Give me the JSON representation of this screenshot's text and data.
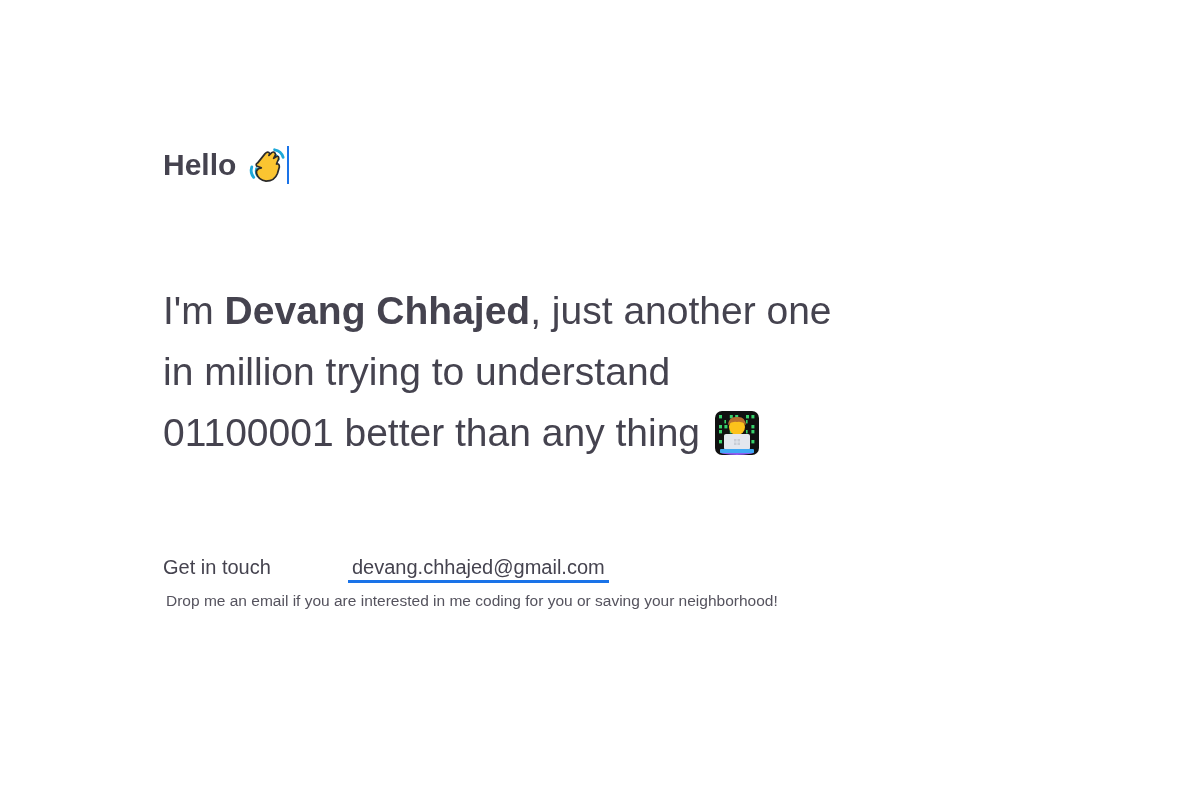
{
  "greeting": {
    "text": "Hello"
  },
  "intro": {
    "lines": [
      "I'm **Devang Chhajed**, just another one",
      "in million trying to understand",
      "01100001 better than any thing"
    ]
  },
  "contact": {
    "label": "Get in touch",
    "email": "devang.chhajed@gmail.com",
    "note": "Drop me an email if you are interested in me coding for you or saving your neighborhood!"
  }
}
